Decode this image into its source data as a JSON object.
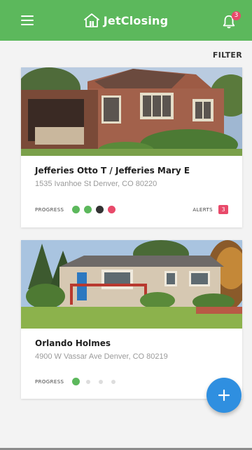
{
  "app": {
    "brand_name": "JetClosing",
    "notifications_count": "3",
    "menu_icon": "menu-icon",
    "bell_icon": "bell-icon",
    "colors": {
      "header": "#5cb85c",
      "accent_pink": "#e84a6a",
      "fab": "#2f8fe0"
    }
  },
  "filter_label": "FILTER",
  "transactions": [
    {
      "title": "Jefferies Otto T / Jefferies Mary E",
      "address": "1535 Ivanhoe St Denver, CO 80220",
      "progress_label": "PROGRESS",
      "progress_steps": [
        "#5cb85c",
        "#5cb85c",
        "#333333",
        "#e84a6a"
      ],
      "alerts_label": "ALERTS",
      "alerts_count": "3"
    },
    {
      "title": "Orlando Holmes",
      "address": "4900 W Vassar Ave Denver, CO 80219",
      "progress_label": "PROGRESS",
      "progress_steps": [
        "#5cb85c",
        "#dddddd",
        "#dddddd",
        "#dddddd"
      ]
    }
  ],
  "fab_icon": "plus-icon"
}
